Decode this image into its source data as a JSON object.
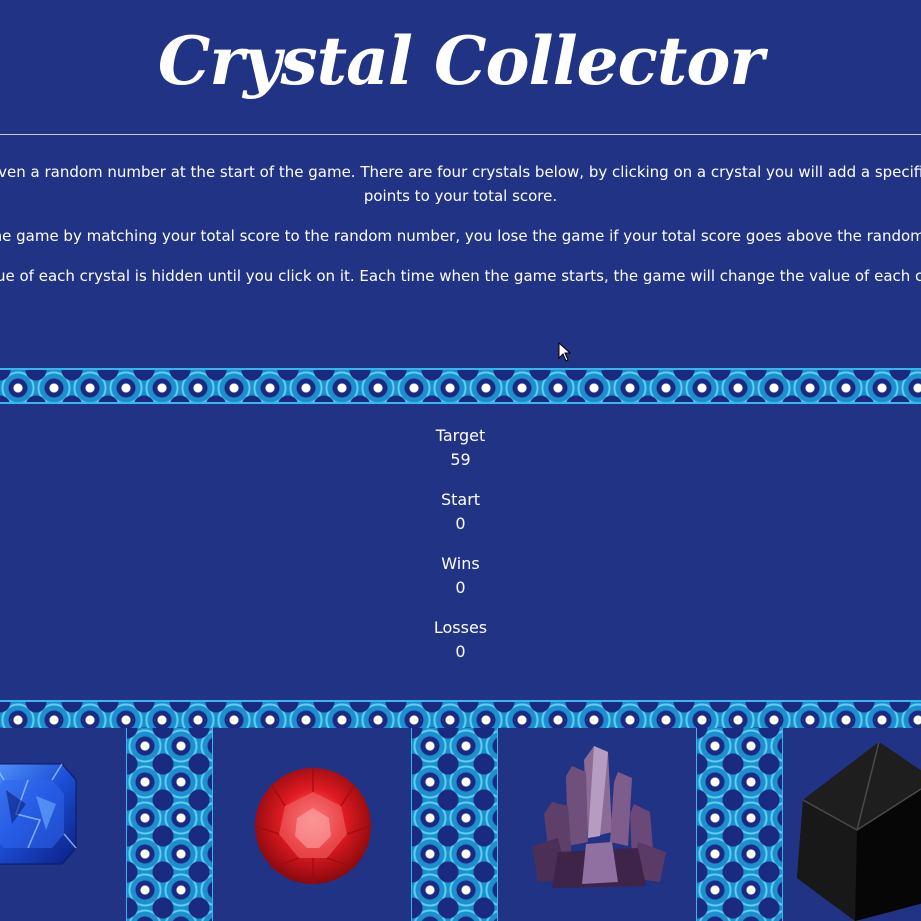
{
  "title": "Crystal Collector",
  "instructions": [
    "be given a random number at the start of the game. There are four crystals below, by clicking on a crystal you will add a specific am",
    "points to your total score.",
    "n the game by matching your total score to the random number, you lose the game if your total score goes above the random nu",
    "e value of each crystal is hidden until you click on it. Each time when the game starts, the game will change the value of each crysta"
  ],
  "stats": {
    "target_label": "Target",
    "target_value": "59",
    "start_label": "Start",
    "start_value": "0",
    "wins_label": "Wins",
    "wins_value": "0",
    "losses_label": "Losses",
    "losses_value": "0"
  },
  "crystals": [
    {
      "name": "blue-sapphire",
      "color": "#1d4fd8"
    },
    {
      "name": "red-ruby",
      "color": "#d3141b"
    },
    {
      "name": "purple-amethyst",
      "color": "#7b5a86"
    },
    {
      "name": "black-cube",
      "color": "#111111"
    }
  ],
  "colors": {
    "background": "#213384",
    "tile_accent": "#1c8fcf",
    "tile_light": "#5fd0f0"
  }
}
